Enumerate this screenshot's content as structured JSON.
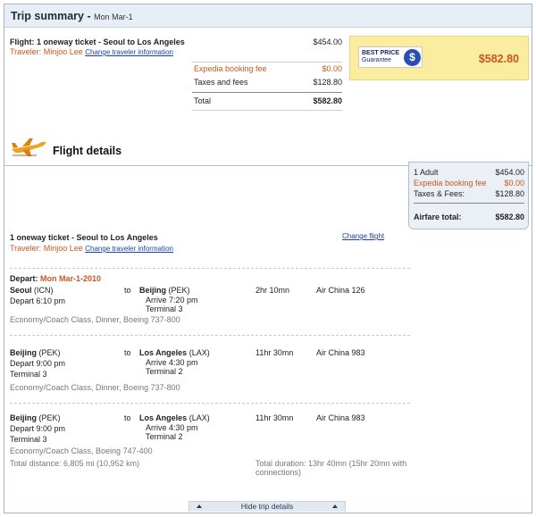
{
  "summary": {
    "title": "Trip summary -",
    "date": "Mon Mar-1",
    "flight_label": "Flight:",
    "flight_desc": "1 oneway ticket - Seoul to Los Angeles",
    "flight_price": "$454.00",
    "traveler_label": "Traveler:",
    "traveler_name": "Minjoo Lee",
    "change_traveler": "Change traveler information",
    "booking_fee_label": "Expedia booking fee",
    "booking_fee": "$0.00",
    "taxes_label": "Taxes and fees",
    "taxes": "$128.80",
    "total_label": "Total",
    "total": "$582.80",
    "best_price_line1": "BEST PRICE",
    "best_price_line2": "Guarantee",
    "best_price_amount": "$582.80"
  },
  "details": {
    "title": "Flight details",
    "airfare": {
      "adult_label": "1 Adult",
      "adult_price": "$454.00",
      "fee_label": "Expedia booking fee",
      "fee": "$0.00",
      "taxes_label": "Taxes & Fees:",
      "taxes": "$128.80",
      "total_label": "Airfare total:",
      "total": "$582.80"
    },
    "ticket_desc": "1 oneway ticket - Seoul to Los Angeles",
    "traveler_label": "Traveler:",
    "traveler_name": "Minjoo Lee",
    "change_traveler": "Change traveler information",
    "change_flight": "Change flight",
    "depart_label": "Depart:",
    "depart_date": "Mon Mar-1-2010",
    "to_label": "to",
    "segments": [
      {
        "from_city": "Seoul",
        "from_code": "(ICN)",
        "depart_time": "Depart 6:10 pm",
        "depart_terminal": "",
        "to_city": "Beijing",
        "to_code": "(PEK)",
        "arrive_time": "Arrive 7:20 pm",
        "arrive_terminal": "Terminal 3",
        "duration": "2hr 10mn",
        "flight": "Air China 126",
        "cabin": "Economy/Coach Class, Dinner, Boeing 737-800"
      },
      {
        "from_city": "Beijing",
        "from_code": "(PEK)",
        "depart_time": "Depart 9:00 pm",
        "depart_terminal": "Terminal 3",
        "to_city": "Los Angeles",
        "to_code": "(LAX)",
        "arrive_time": "Arrive 4:30 pm",
        "arrive_terminal": "Terminal 2",
        "duration": "11hr 30mn",
        "flight": "Air China 983",
        "cabin": "Economy/Coach Class, Dinner, Boeing 737-800"
      },
      {
        "from_city": "Beijing",
        "from_code": "(PEK)",
        "depart_time": "Depart 9:00 pm",
        "depart_terminal": "Terminal 3",
        "to_city": "Los Angeles",
        "to_code": "(LAX)",
        "arrive_time": "Arrive 4:30 pm",
        "arrive_terminal": "Terminal 2",
        "duration": "11hr 30mn",
        "flight": "Air China 983",
        "cabin": "Economy/Coach Class, Boeing 747-400"
      }
    ],
    "total_distance": "Total distance: 6,805 mi (10,952 km)",
    "total_duration_line1": "Total duration: 13hr 40mn (15hr 20mn with",
    "total_duration_line2": "connections)",
    "hide_details": "Hide trip details"
  },
  "icons": {
    "plane": "airplane-icon",
    "best_price": "best-price-badge-icon",
    "arrow": "triangle-up-icon"
  },
  "colors": {
    "accent_orange": "#c9571d",
    "link_blue": "#1a3fb0",
    "header_bg": "#e8eef6",
    "badge_bg": "#fbeda0"
  }
}
